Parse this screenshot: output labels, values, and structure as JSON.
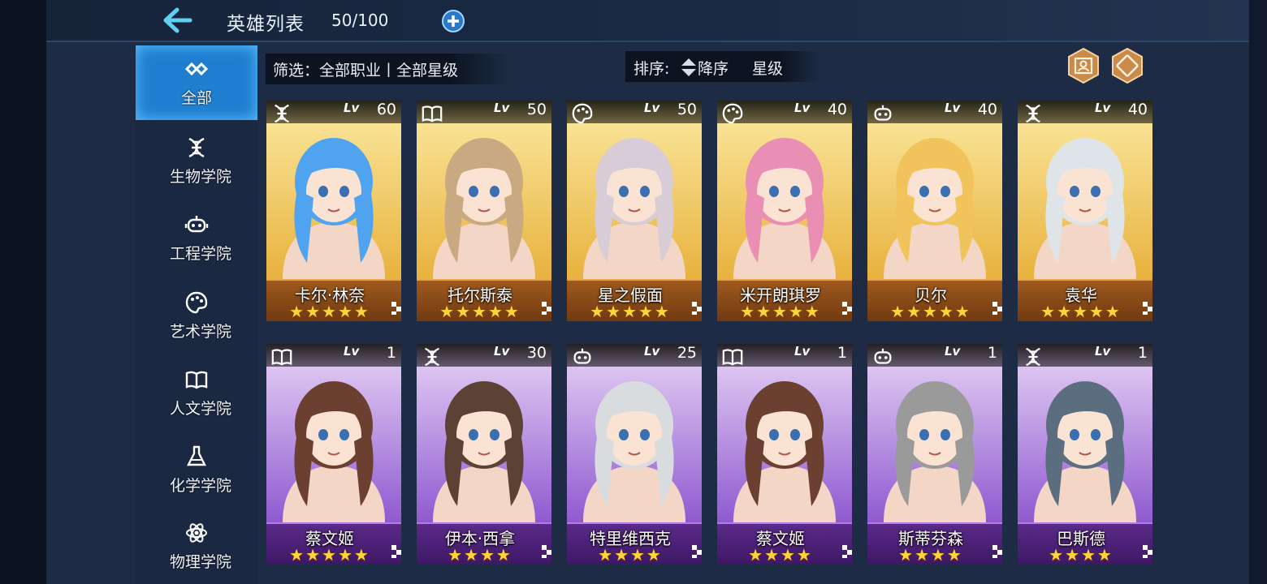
{
  "header": {
    "title": "英雄列表",
    "count": "50/100"
  },
  "sidebar": {
    "items": [
      {
        "label": "全部",
        "icon": "infinity-icon"
      },
      {
        "label": "生物学院",
        "icon": "dna-icon"
      },
      {
        "label": "工程学院",
        "icon": "robot-icon"
      },
      {
        "label": "艺术学院",
        "icon": "palette-icon"
      },
      {
        "label": "人文学院",
        "icon": "book-icon"
      },
      {
        "label": "化学学院",
        "icon": "flask-icon"
      },
      {
        "label": "物理学院",
        "icon": "atom-icon"
      }
    ]
  },
  "filter": {
    "text": "筛选：全部职业丨全部星级"
  },
  "sort": {
    "label": "排序:",
    "order": "降序",
    "key": "星级"
  },
  "level_prefix": "Lv",
  "heroes": [
    {
      "name": "卡尔·林奈",
      "level": "60",
      "stars": "★★★★★",
      "class_icon": "dna-icon",
      "rarity": "gold",
      "hair": "#4fa3ef"
    },
    {
      "name": "托尔斯泰",
      "level": "50",
      "stars": "★★★★★",
      "class_icon": "book-icon",
      "rarity": "gold",
      "hair": "#c9a982"
    },
    {
      "name": "星之假面",
      "level": "50",
      "stars": "★★★★★",
      "class_icon": "palette-icon",
      "rarity": "gold",
      "hair": "#d8cdd6"
    },
    {
      "name": "米开朗琪罗",
      "level": "40",
      "stars": "★★★★★",
      "class_icon": "palette-icon",
      "rarity": "gold",
      "hair": "#e98fb4"
    },
    {
      "name": "贝尔",
      "level": "40",
      "stars": "★★★★★",
      "class_icon": "robot-icon",
      "rarity": "gold",
      "hair": "#f0c45b"
    },
    {
      "name": "袁华",
      "level": "40",
      "stars": "★★★★★",
      "class_icon": "dna-icon",
      "rarity": "gold",
      "hair": "#dfe4e8"
    },
    {
      "name": "蔡文姬",
      "level": "1",
      "stars": "★★★★★",
      "class_icon": "book-icon",
      "rarity": "purple",
      "hair": "#6b4030"
    },
    {
      "name": "伊本·西拿",
      "level": "30",
      "stars": "★★★★",
      "class_icon": "dna-icon",
      "rarity": "purple",
      "hair": "#5c4234"
    },
    {
      "name": "特里维西克",
      "level": "25",
      "stars": "★★★★",
      "class_icon": "robot-icon",
      "rarity": "purple",
      "hair": "#d9dcdf"
    },
    {
      "name": "蔡文姬",
      "level": "1",
      "stars": "★★★★",
      "class_icon": "book-icon",
      "rarity": "purple",
      "hair": "#6b4030"
    },
    {
      "name": "斯蒂芬森",
      "level": "1",
      "stars": "★★★★",
      "class_icon": "robot-icon",
      "rarity": "purple",
      "hair": "#9a9a9a"
    },
    {
      "name": "巴斯德",
      "level": "1",
      "stars": "★★★★",
      "class_icon": "dna-icon",
      "rarity": "purple",
      "hair": "#5b6e80"
    }
  ],
  "colors": {
    "accent": "#1f7ed0",
    "gold_bar": "#8a4a18",
    "purple_bar": "#4a2070",
    "star": "#ffd53a",
    "back_arrow": "#5fd0f0"
  }
}
